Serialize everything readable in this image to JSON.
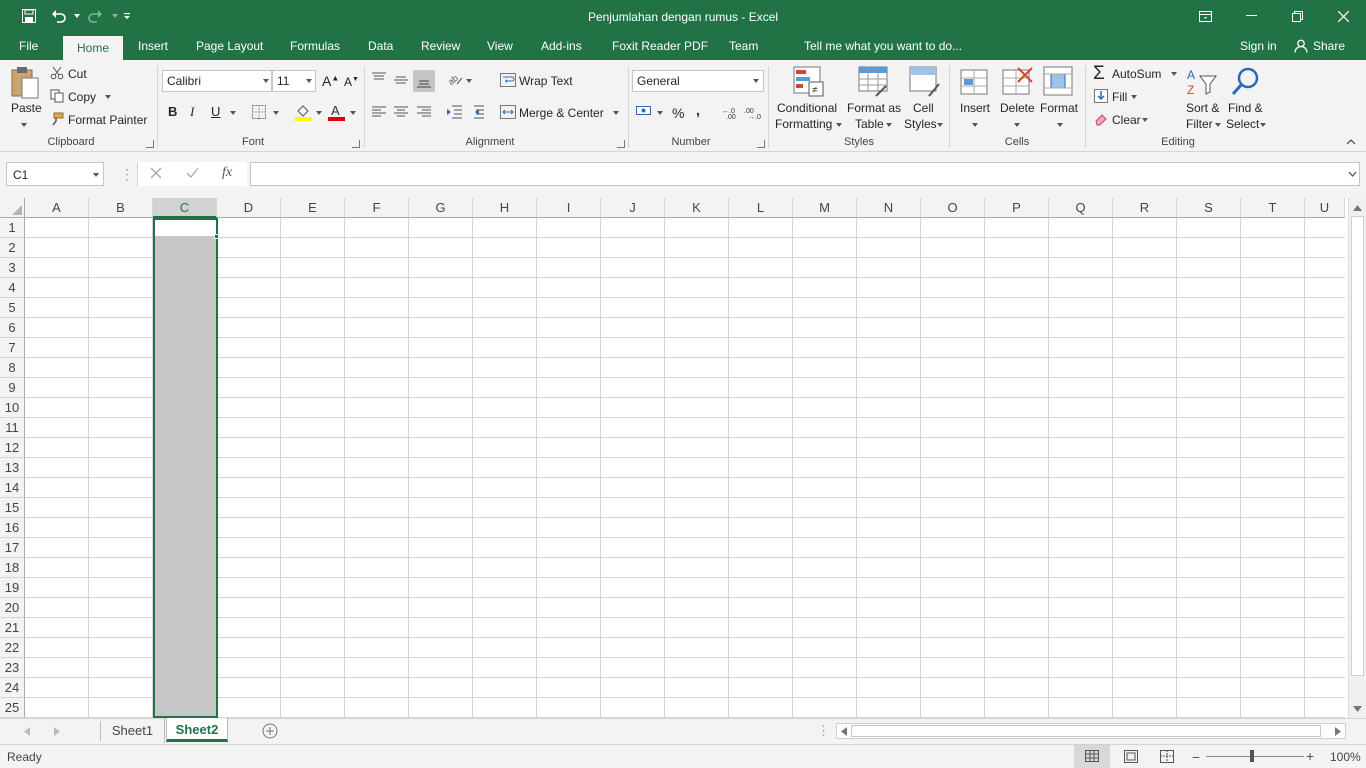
{
  "window": {
    "title": "Penjumlahan dengan rumus - Excel"
  },
  "tabs": {
    "file": "File",
    "home": "Home",
    "insert": "Insert",
    "page_layout": "Page Layout",
    "formulas": "Formulas",
    "data": "Data",
    "review": "Review",
    "view": "View",
    "addins": "Add-ins",
    "foxit": "Foxit Reader PDF",
    "team": "Team",
    "tell_me": "Tell me what you want to do...",
    "sign_in": "Sign in",
    "share": "Share"
  },
  "ribbon": {
    "clipboard": {
      "paste": "Paste",
      "cut": "Cut",
      "copy": "Copy",
      "format_painter": "Format Painter",
      "label": "Clipboard"
    },
    "font": {
      "name": "Calibri",
      "size": "11",
      "bold": "B",
      "italic": "I",
      "underline": "U",
      "label": "Font"
    },
    "alignment": {
      "wrap_text": "Wrap Text",
      "merge_center": "Merge & Center",
      "label": "Alignment"
    },
    "number": {
      "format": "General",
      "percent": "%",
      "comma": ",",
      "label": "Number"
    },
    "styles": {
      "conditional_1": "Conditional",
      "conditional_2": "Formatting",
      "format_table_1": "Format as",
      "format_table_2": "Table",
      "cell_styles_1": "Cell",
      "cell_styles_2": "Styles",
      "label": "Styles"
    },
    "cells": {
      "insert": "Insert",
      "delete": "Delete",
      "format": "Format",
      "label": "Cells"
    },
    "editing": {
      "autosum": "AutoSum",
      "fill": "Fill",
      "clear": "Clear",
      "sort_1": "Sort &",
      "sort_2": "Filter",
      "find_1": "Find &",
      "find_2": "Select",
      "label": "Editing"
    }
  },
  "formula_bar": {
    "name_box": "C1",
    "fx": "fx",
    "value": ""
  },
  "grid": {
    "columns": [
      "A",
      "B",
      "C",
      "D",
      "E",
      "F",
      "G",
      "H",
      "I",
      "J",
      "K",
      "L",
      "M",
      "N",
      "O",
      "P",
      "Q",
      "R",
      "S",
      "T",
      "U"
    ],
    "rows": [
      "1",
      "2",
      "3",
      "4",
      "5",
      "6",
      "7",
      "8",
      "9",
      "10",
      "11",
      "12",
      "13",
      "14",
      "15",
      "16",
      "17",
      "18",
      "19",
      "20",
      "21",
      "22",
      "23",
      "24",
      "25"
    ],
    "selected_column": "C",
    "active_cell": "C1"
  },
  "sheets": {
    "tabs": [
      "Sheet1",
      "Sheet2"
    ],
    "active": "Sheet2"
  },
  "status": {
    "mode": "Ready",
    "zoom": "100%"
  },
  "colors": {
    "brand": "#217346",
    "selection": "#c6c6c6"
  }
}
